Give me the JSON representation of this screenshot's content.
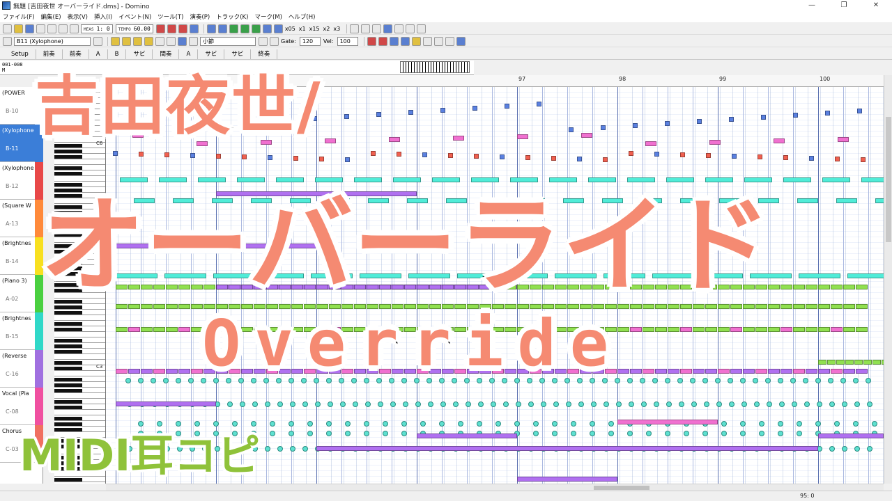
{
  "window": {
    "title": "無題 [吉田夜世 オーバーライド.dms] - Domino",
    "controls": [
      "—",
      "❐",
      "✕"
    ]
  },
  "menu": [
    "ファイル(F)",
    "編集(E)",
    "表示(V)",
    "挿入(I)",
    "イベント(N)",
    "ツール(T)",
    "演奏(P)",
    "トラック(K)",
    "マーク(M)",
    "ヘルプ(H)"
  ],
  "toolbar": {
    "meas_label": "MEAS",
    "meas_value": "1:  0",
    "tempo_label": "TEMPO",
    "tempo_value": "60.00",
    "speeds": [
      "x05",
      "x1",
      "x15",
      "x2",
      "x3"
    ],
    "track_select": "B11 (Xylophone)",
    "grid_select": "小節",
    "gate_label": "Gate:",
    "gate_value": "120",
    "vel_label": "Vel:",
    "vel_value": "100"
  },
  "tabs": [
    "Setup",
    "前奏",
    "前奏",
    "A",
    "B",
    "サビ",
    "間奏",
    "A",
    "サビ",
    "サビ",
    "終奏"
  ],
  "measure_strip": {
    "range": "001-008",
    "mode": "M"
  },
  "ruler": {
    "measures": [
      "97",
      "98",
      "99",
      "100"
    ]
  },
  "tracks": [
    {
      "name": "(POWER",
      "port": "B-10",
      "color": "#ffffff",
      "selected": false
    },
    {
      "name": "(Xylophone",
      "port": "B-11",
      "color": "#3b7ed8",
      "selected": true
    },
    {
      "name": "(Xylophone)",
      "port": "B-12",
      "color": "#e84848",
      "selected": false
    },
    {
      "name": "(Square W",
      "port": "A-13",
      "color": "#ff8a3a",
      "selected": false
    },
    {
      "name": "(Brightnes",
      "port": "B-14",
      "color": "#f8e020",
      "selected": false
    },
    {
      "name": "(Piano 3)",
      "port": "A-02",
      "color": "#4ad040",
      "selected": false
    },
    {
      "name": "(Brightnes",
      "port": "B-15",
      "color": "#30d8c8",
      "selected": false
    },
    {
      "name": "(Reverse",
      "port": "C-16",
      "color": "#a070e0",
      "selected": false
    },
    {
      "name": "Vocal (Pia",
      "port": "C-08",
      "color": "#f050a0",
      "selected": false
    },
    {
      "name": "Chorus",
      "port": "C-03",
      "color": "#f07060",
      "selected": false
    }
  ],
  "keyboard": {
    "octaves": [
      "C6",
      "C3"
    ]
  },
  "status": {
    "position": "95: 0"
  },
  "overlay": {
    "artist": "吉田夜世/",
    "title": "オーバーライド",
    "subtitle": "Override",
    "tag": "MIDI耳コピ"
  },
  "colors": {
    "note_blue": "#5a80e0",
    "note_pink": "#f070d0",
    "note_cyan": "#50ecd8",
    "note_green": "#90e050",
    "note_purple": "#b070f0",
    "note_red": "#f06050",
    "overlay_fill": "#f58a72",
    "tag_green": "#8fc23a"
  }
}
